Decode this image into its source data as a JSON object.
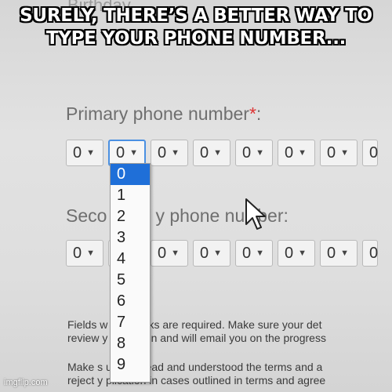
{
  "caption": "SURELY, THERE’S A BETTER WAY TO TYPE YOUR PHONE NUMBER...",
  "birthday_label": "Birthday",
  "primary": {
    "label": "Primary phone number",
    "required_mark": "*",
    "suffix": ":",
    "digits": [
      "0",
      "0",
      "0",
      "0",
      "0",
      "0",
      "0",
      "0"
    ]
  },
  "dropdown": {
    "options": [
      "0",
      "1",
      "2",
      "3",
      "4",
      "5",
      "6",
      "7",
      "8",
      "9"
    ],
    "selected": "0"
  },
  "secondary": {
    "label_start": "Seco",
    "label_mid": "y phone nu",
    "label_end": "ber:",
    "digits": [
      "0",
      "",
      "0",
      "0",
      "0",
      "0",
      "0",
      "0"
    ]
  },
  "notes": {
    "line1": "Fields w      l asterisks are required. Make sure your det",
    "line2": "review y      pplication and will email you on the progress",
    "line3": "Make s      u have read and understood the terms and a",
    "line4": "reject y      plication in cases outlined in terms and agree"
  },
  "watermark": "imgflip.com",
  "colors": {
    "accent": "#1f6fd8",
    "required": "#dd3333"
  }
}
